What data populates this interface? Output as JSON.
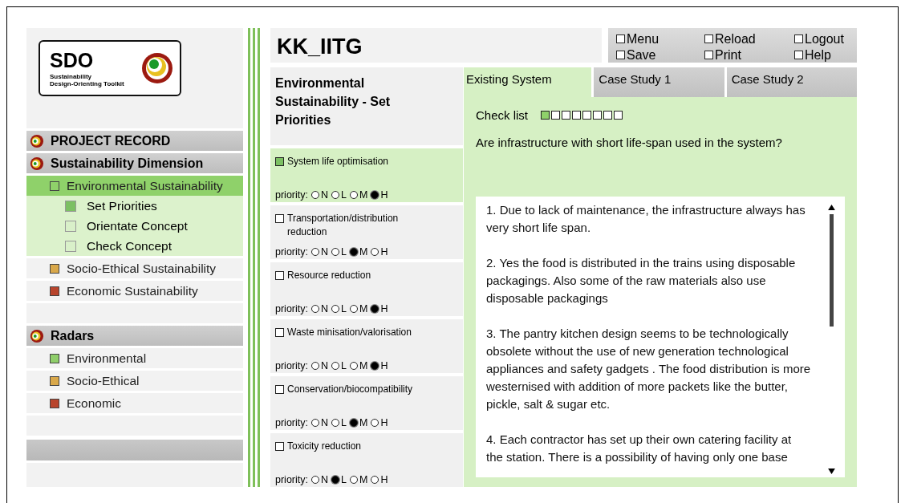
{
  "logo": {
    "title": "SDO",
    "subtitle": [
      "Sustainability",
      "Design-Orienting Toolkit"
    ]
  },
  "sidebar": {
    "sections": [
      {
        "title": "PROJECT RECORD"
      },
      {
        "title": "Sustainability Dimension",
        "items": [
          {
            "label": "Environmental Sustainability",
            "selected": true,
            "children": [
              {
                "label": "Set Priorities",
                "selected": true
              },
              {
                "label": "Orientate Concept",
                "selected": false
              },
              {
                "label": "Check Concept",
                "selected": false
              }
            ]
          },
          {
            "label": "Socio-Ethical Sustainability",
            "color": "#d9a84a",
            "selected": false
          },
          {
            "label": "Economic Sustainability",
            "color": "#b8442c",
            "selected": false
          }
        ]
      },
      {
        "title": "Radars",
        "items": [
          {
            "label": "Environmental",
            "color": "#8fce6a",
            "selected": false
          },
          {
            "label": "Socio-Ethical",
            "color": "#d9a84a",
            "selected": false
          },
          {
            "label": "Economic",
            "color": "#b8442c",
            "selected": false
          }
        ]
      }
    ]
  },
  "project_title": "KK_IITG",
  "menu": [
    {
      "label": "Menu",
      "checked": false
    },
    {
      "label": "Reload",
      "checked": false
    },
    {
      "label": "Logout",
      "checked": false
    },
    {
      "label": "Save",
      "checked": false
    },
    {
      "label": "Print",
      "checked": false
    },
    {
      "label": "Help",
      "checked": false
    }
  ],
  "heading": "Environmental Sustainability - Set Priorities",
  "criteria": [
    {
      "label": "System life optimisation",
      "selected": true,
      "priority_label": "priority:",
      "options": [
        {
          "label": "N",
          "selected": false
        },
        {
          "label": "L",
          "selected": false
        },
        {
          "label": "M",
          "selected": false
        },
        {
          "label": "H",
          "selected": true
        }
      ]
    },
    {
      "label": "Transportation/distribution reduction",
      "selected": false,
      "priority_label": "priority:",
      "options": [
        {
          "label": "N",
          "selected": false
        },
        {
          "label": "L",
          "selected": false
        },
        {
          "label": "M",
          "selected": true
        },
        {
          "label": "H",
          "selected": false
        }
      ]
    },
    {
      "label": "Resource reduction",
      "selected": false,
      "priority_label": "priority:",
      "options": [
        {
          "label": "N",
          "selected": false
        },
        {
          "label": "L",
          "selected": false
        },
        {
          "label": "M",
          "selected": false
        },
        {
          "label": "H",
          "selected": true
        }
      ]
    },
    {
      "label": "Waste minisation/valorisation",
      "selected": false,
      "priority_label": "priority:",
      "options": [
        {
          "label": "N",
          "selected": false
        },
        {
          "label": "L",
          "selected": false
        },
        {
          "label": "M",
          "selected": false
        },
        {
          "label": "H",
          "selected": true
        }
      ]
    },
    {
      "label": "Conservation/biocompatibility",
      "selected": false,
      "priority_label": "priority:",
      "options": [
        {
          "label": "N",
          "selected": false
        },
        {
          "label": "L",
          "selected": false
        },
        {
          "label": "M",
          "selected": true
        },
        {
          "label": "H",
          "selected": false
        }
      ]
    },
    {
      "label": "Toxicity reduction",
      "selected": false,
      "priority_label": "priority:",
      "options": [
        {
          "label": "N",
          "selected": false
        },
        {
          "label": "L",
          "selected": true
        },
        {
          "label": "M",
          "selected": false
        },
        {
          "label": "H",
          "selected": false
        }
      ]
    }
  ],
  "tabs": [
    {
      "label": "Existing System",
      "selected": true
    },
    {
      "label": "Case Study 1",
      "selected": false
    },
    {
      "label": "Case Study 2",
      "selected": false
    }
  ],
  "checklist": {
    "label": "Check list",
    "boxes": [
      {
        "checked": true
      },
      {
        "checked": false
      },
      {
        "checked": false
      },
      {
        "checked": false
      },
      {
        "checked": false
      },
      {
        "checked": false
      },
      {
        "checked": false
      },
      {
        "checked": false
      }
    ]
  },
  "question": "Are infrastructure with short life-span used in the system?",
  "answers": [
    "1. Due to lack of maintenance, the infrastructure always has very short life span.",
    "2. Yes the food is distributed in the trains using disposable packagings. Also some of the raw materials also use disposable packagings",
    "3. The pantry kitchen design seems to be technologically obsolete without the use of new generation technological appliances and safety gadgets . The food distribution is more westernised with addition of more packets like the butter, pickle, salt & sugar etc.",
    "4. Each contractor has set up their own catering facility at the station. There is a possibility of having only one base"
  ]
}
